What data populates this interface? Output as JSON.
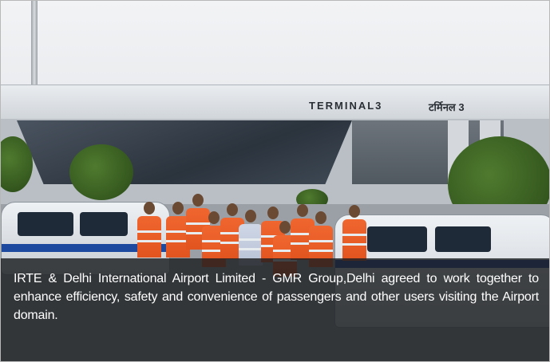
{
  "signage": {
    "terminal_en": "TERMINAL3",
    "terminal_hi": "टर्मिनल 3"
  },
  "caption": {
    "text": "IRTE & Delhi International Airport Limited - GMR Group,Delhi agreed to work together to enhance efficiency, safety and convenience of passengers and other users visiting the Airport domain."
  },
  "colors": {
    "vest": "#e2541f",
    "caption_band": "#1c1e21",
    "car_stripe": "#1d4a9e"
  }
}
